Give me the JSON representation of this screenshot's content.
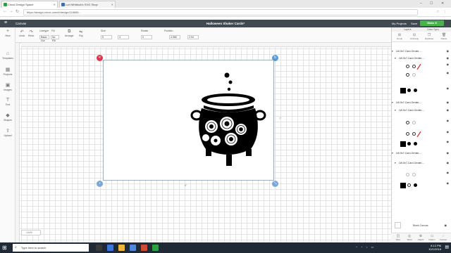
{
  "browser": {
    "tabs": [
      {
        "label": "Cricut Design Space",
        "active": true
      },
      {
        "label": "Lori Whitlock's SVG Shop",
        "active": false
      }
    ],
    "url": "https://design.cricut.com/#/design/118665..."
  },
  "app": {
    "canvas_label": "Canvas",
    "project_title": "Halloween Shaker Cards*",
    "my_projects": "My Projects",
    "save": "Save",
    "make_it": "Make It"
  },
  "toolbar": {
    "undo": "Undo",
    "redo": "Redo",
    "linetype": "Linetype",
    "linetype_value": "Basic Cut",
    "fill": "Fill",
    "fill_value": "No Fill",
    "arrange": "Arrange",
    "flip": "Flip",
    "size": "Size",
    "w_value": "5",
    "h_value": "4",
    "rotate": "Rotate",
    "rotate_value": "0",
    "position": "Position",
    "x_value": "4.966",
    "y_value": "2.94"
  },
  "left_rail": [
    "New",
    "Templates",
    "Projects",
    "Images",
    "Text",
    "Shapes",
    "Upload"
  ],
  "canvas": {
    "width_label": "5\"",
    "height_label": "7\"",
    "zoom": "100%"
  },
  "panel": {
    "tabs": [
      "Layers",
      "Color Sync"
    ],
    "actions": [
      "Group",
      "UnGroup",
      "Duplicate",
      "Delete"
    ],
    "layers": [
      {
        "name": "LW-5x7-Card-Ornate-...",
        "child": "LW-5x7-Card-Ornate-..."
      },
      {
        "name": "LW-5x7-Card-Ornate-...",
        "child": "LW-5x7-Card-Ornate-..."
      },
      {
        "name": "LW-5x7-Card-Ornate-...",
        "child": "LW-5x7-Card-Ornate-..."
      }
    ],
    "blank_canvas": "Blank Canvas",
    "footer": [
      "Slice",
      "Weld",
      "Attach",
      "Flatten",
      "Contour"
    ]
  },
  "taskbar": {
    "search": "Type here to search",
    "time": "8:13 PM",
    "date": "10/1/2018"
  },
  "colors": {
    "header_bg": "#414a52",
    "make_it_green": "#4caf50",
    "delete_handle": "#e0344a",
    "selection_blue": "#5b9bd5",
    "swatch_red": "#d92b2b"
  }
}
